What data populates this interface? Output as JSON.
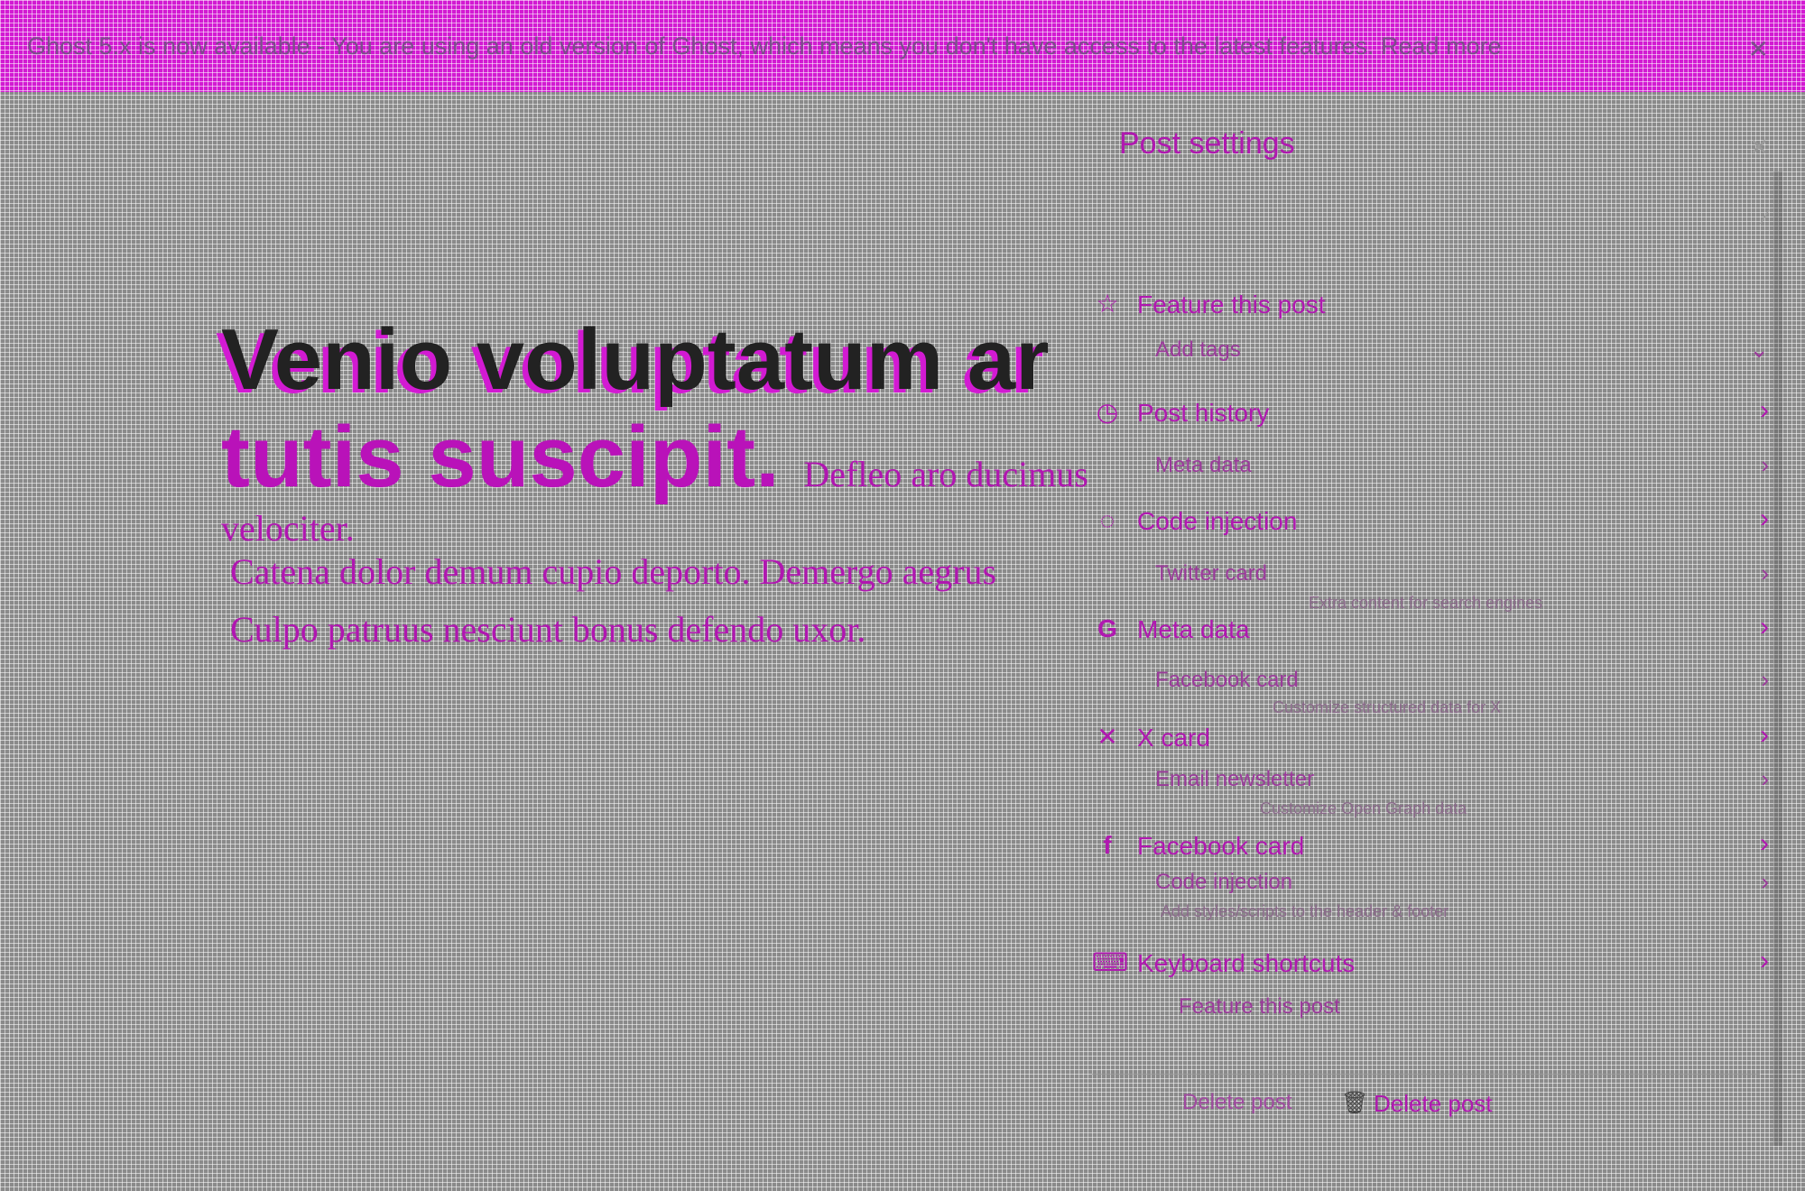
{
  "banner": {
    "text": "Ghost 5.x is now available - You are using an old version of Ghost, which means you don't have access to the latest features. Read more",
    "close_icon": "close-icon"
  },
  "editor": {
    "title_line1": "Venio voluptatum ar",
    "title_line2": "tutis suscipit.",
    "title_inline_excerpt": "Defleo aro ducimus",
    "excerpt_line0": "velociter.",
    "excerpt_line1": "Catena dolor demum cupio deporto. Demergo aegrus",
    "excerpt_line2": "Culpo patruus nesciunt bonus defendo uxor."
  },
  "panel": {
    "title": "Post settings",
    "close_icon": "close-icon",
    "pin_icon": "pin-icon",
    "items": [
      {
        "icon": "star-icon",
        "glyph": "☆",
        "label": "Feature this post"
      },
      {
        "icon": "clock-icon",
        "glyph": "◷",
        "label": "Post history"
      },
      {
        "icon": "code-icon",
        "glyph": "◌",
        "label": "Code injection"
      },
      {
        "icon": "google-icon",
        "glyph": "G",
        "label": "Meta data"
      },
      {
        "icon": "x-icon",
        "glyph": "✕",
        "label": "X card"
      },
      {
        "icon": "facebook-icon",
        "glyph": "f",
        "label": "Facebook card"
      },
      {
        "icon": "keyboard-icon",
        "glyph": "⌨",
        "label": "Keyboard shortcuts"
      }
    ],
    "sub_items": [
      {
        "label": "Add tags"
      },
      {
        "label": "Meta data"
      },
      {
        "label": "Twitter card"
      },
      {
        "label": "Facebook card"
      },
      {
        "label": "Email newsletter"
      },
      {
        "label": "Code injection"
      },
      {
        "label": "Feature this post"
      }
    ],
    "hints": [
      "Extra content for search engines",
      "Customize structured data for X",
      "Customize Open Graph data",
      "Add styles/scripts to the header & footer"
    ],
    "delete_ghost": "Delete post",
    "delete_icon": "trash-icon",
    "delete_label": "Delete post"
  }
}
